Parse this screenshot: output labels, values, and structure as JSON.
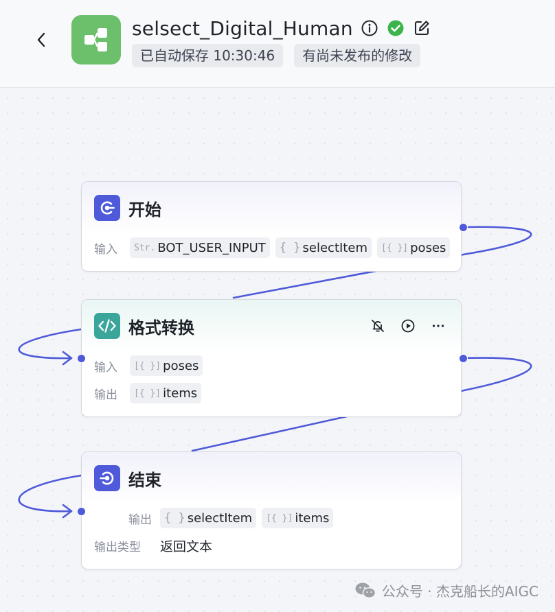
{
  "header": {
    "title": "selsect_Digital_Human",
    "autosave": "已自动保存 10:30:46",
    "unpublished": "有尚未发布的修改"
  },
  "colors": {
    "logo": "#6cc06b",
    "edge": "#4e5ad9",
    "success": "#3cb44b",
    "start_icon": "#4e5ad9",
    "code_icon": "#3aa59a",
    "end_icon": "#4e5ad9"
  },
  "icons": {
    "back": "chevron-left-icon",
    "logo": "workflow-icon",
    "info": "info-icon",
    "status": "check-circle-icon",
    "edit": "edit-icon",
    "mute": "bell-off-icon",
    "run": "play-icon",
    "more": "more-icon",
    "watermark": "wechat-icon"
  },
  "nodes": {
    "start": {
      "title": "开始",
      "input_label": "输入",
      "inputs": [
        {
          "type": "Str.",
          "name": "BOT_USER_INPUT"
        },
        {
          "type": "{ }",
          "name": "selectItem"
        },
        {
          "type": "[{ }]",
          "name": "poses"
        }
      ]
    },
    "code": {
      "title": "格式转换",
      "input_label": "输入",
      "output_label": "输出",
      "inputs": [
        {
          "type": "[{ }]",
          "name": "poses"
        }
      ],
      "outputs": [
        {
          "type": "[{ }]",
          "name": "items"
        }
      ]
    },
    "end": {
      "title": "结束",
      "output_label": "输出",
      "outputs": [
        {
          "type": "{ }",
          "name": "selectItem"
        },
        {
          "type": "[{ }]",
          "name": "items"
        }
      ],
      "output_type_label": "输出类型",
      "output_type_value": "返回文本"
    }
  },
  "watermark": "公众号 · 杰克船长的AIGC"
}
